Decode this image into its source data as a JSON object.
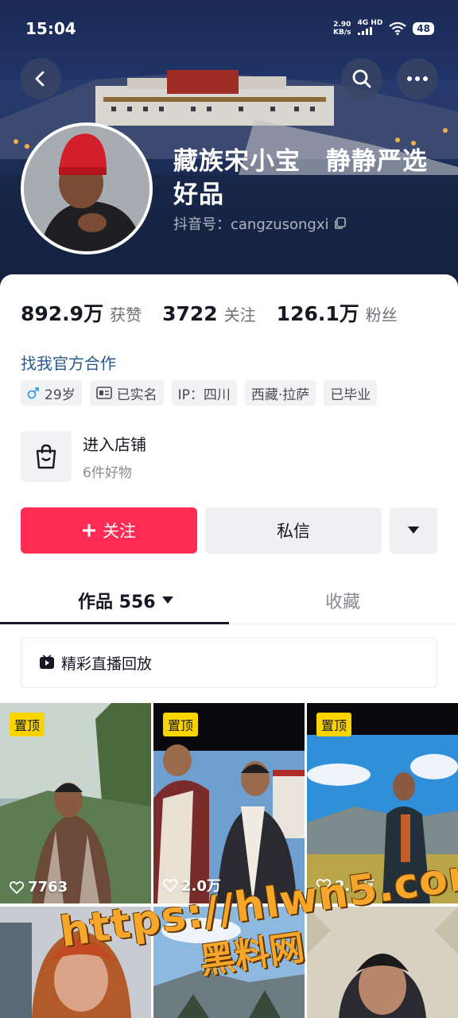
{
  "status_bar": {
    "time": "15:04",
    "speed_value": "2.90",
    "speed_unit": "KB/s",
    "network": "4G HD",
    "battery": "48"
  },
  "profile": {
    "name": "藏族宋小宝　静静严选好品",
    "douyin_id": "抖音号：cangzusongxi"
  },
  "stats": [
    {
      "value": "892.9万",
      "label": "获赞"
    },
    {
      "value": "3722",
      "label": "关注"
    },
    {
      "value": "126.1万",
      "label": "粉丝"
    }
  ],
  "cooperation_link": "找我官方合作",
  "tags": [
    {
      "icon": "male-icon",
      "text": "29岁"
    },
    {
      "icon": "id-card-icon",
      "text": "已实名"
    },
    {
      "icon": "",
      "text": "IP：四川"
    },
    {
      "icon": "",
      "text": "西藏·拉萨"
    },
    {
      "icon": "",
      "text": "已毕业"
    }
  ],
  "shop": {
    "title": "进入店铺",
    "subtitle": "6件好物"
  },
  "buttons": {
    "follow": "关注",
    "message": "私信"
  },
  "tabs": {
    "works": "作品 556",
    "favorites": "收藏"
  },
  "replay_label": "精彩直播回放",
  "videos": [
    {
      "pinned": "置顶",
      "likes": "7763"
    },
    {
      "pinned": "置顶",
      "likes": "2.0万"
    },
    {
      "pinned": "置顶",
      "likes": "2.2万"
    },
    {
      "pinned": "",
      "likes": ""
    },
    {
      "pinned": "",
      "likes": ""
    },
    {
      "pinned": "",
      "likes": ""
    }
  ],
  "watermark": {
    "url": "https://hlwn5.com",
    "text": "黑料网"
  },
  "colors": {
    "follow_button": "#fe2c55",
    "pin_badge": "#fad400",
    "link": "#2a5a8c"
  }
}
